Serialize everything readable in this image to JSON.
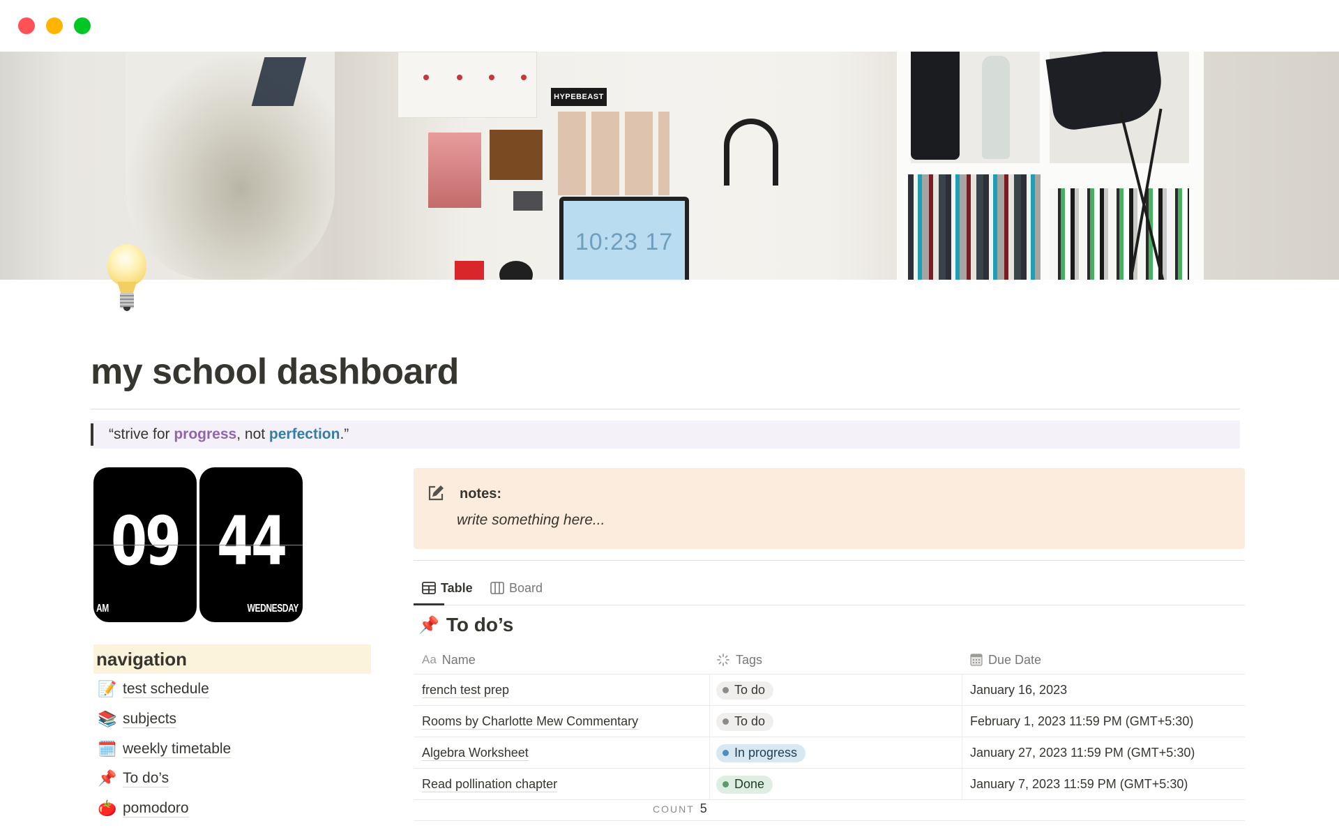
{
  "window": {
    "traffic_lights": [
      "close",
      "minimize",
      "zoom"
    ]
  },
  "cover": {
    "description": "desk workspace photo",
    "laptop_clock": "10:23 17",
    "sticker_text": "HYPEBEAST"
  },
  "page": {
    "icon": "light-bulb-icon",
    "title": "my school dashboard"
  },
  "quote": {
    "prefix": "“strive for ",
    "highlight1": "progress",
    "middle": ", not ",
    "highlight2": "perfection",
    "suffix": ".”",
    "colors": {
      "highlight1": "#9065b0",
      "highlight2": "#337ea9"
    }
  },
  "clock": {
    "hours": "09",
    "minutes": "44",
    "meridiem": "AM",
    "weekday": "WEDNESDAY"
  },
  "navigation": {
    "heading": "navigation",
    "items": [
      {
        "emoji": "📝",
        "icon": "memo-icon",
        "label": "test schedule"
      },
      {
        "emoji": "📚",
        "icon": "books-icon",
        "label": "subjects"
      },
      {
        "emoji": "🗓️",
        "icon": "calendar-icon",
        "label": "weekly timetable"
      },
      {
        "emoji": "📌",
        "icon": "pushpin-link-icon",
        "label": "To do’s"
      },
      {
        "emoji": "🍅",
        "icon": "tomato-icon",
        "label": "pomodoro"
      }
    ]
  },
  "callout": {
    "icon": "edit-note-icon",
    "title": "notes:",
    "body": "write something here..."
  },
  "views": {
    "tabs": [
      {
        "label": "Table",
        "icon": "table-icon",
        "active": true
      },
      {
        "label": "Board",
        "icon": "board-icon",
        "active": false
      }
    ]
  },
  "database": {
    "emoji": "📌",
    "title": "To do’s",
    "columns": [
      {
        "label": "Name",
        "icon": "Aa"
      },
      {
        "label": "Tags",
        "icon": "status-icon"
      },
      {
        "label": "Due Date",
        "icon": "calendar-icon"
      }
    ],
    "rows": [
      {
        "name": "french test prep",
        "tag": "To do",
        "tag_style": "todo",
        "due": "January 16, 2023"
      },
      {
        "name": "Rooms by Charlotte Mew Commentary",
        "tag": "To do",
        "tag_style": "todo",
        "due": "February 1, 2023 11:59 PM (GMT+5:30)"
      },
      {
        "name": "Algebra Worksheet",
        "tag": "In progress",
        "tag_style": "prog",
        "due": "January 27, 2023 11:59 PM (GMT+5:30)"
      },
      {
        "name": "Read pollination chapter",
        "tag": "Done",
        "tag_style": "done",
        "due": "January 7, 2023 11:59 PM (GMT+5:30)"
      }
    ],
    "count_label": "COUNT",
    "count_value": "5"
  }
}
